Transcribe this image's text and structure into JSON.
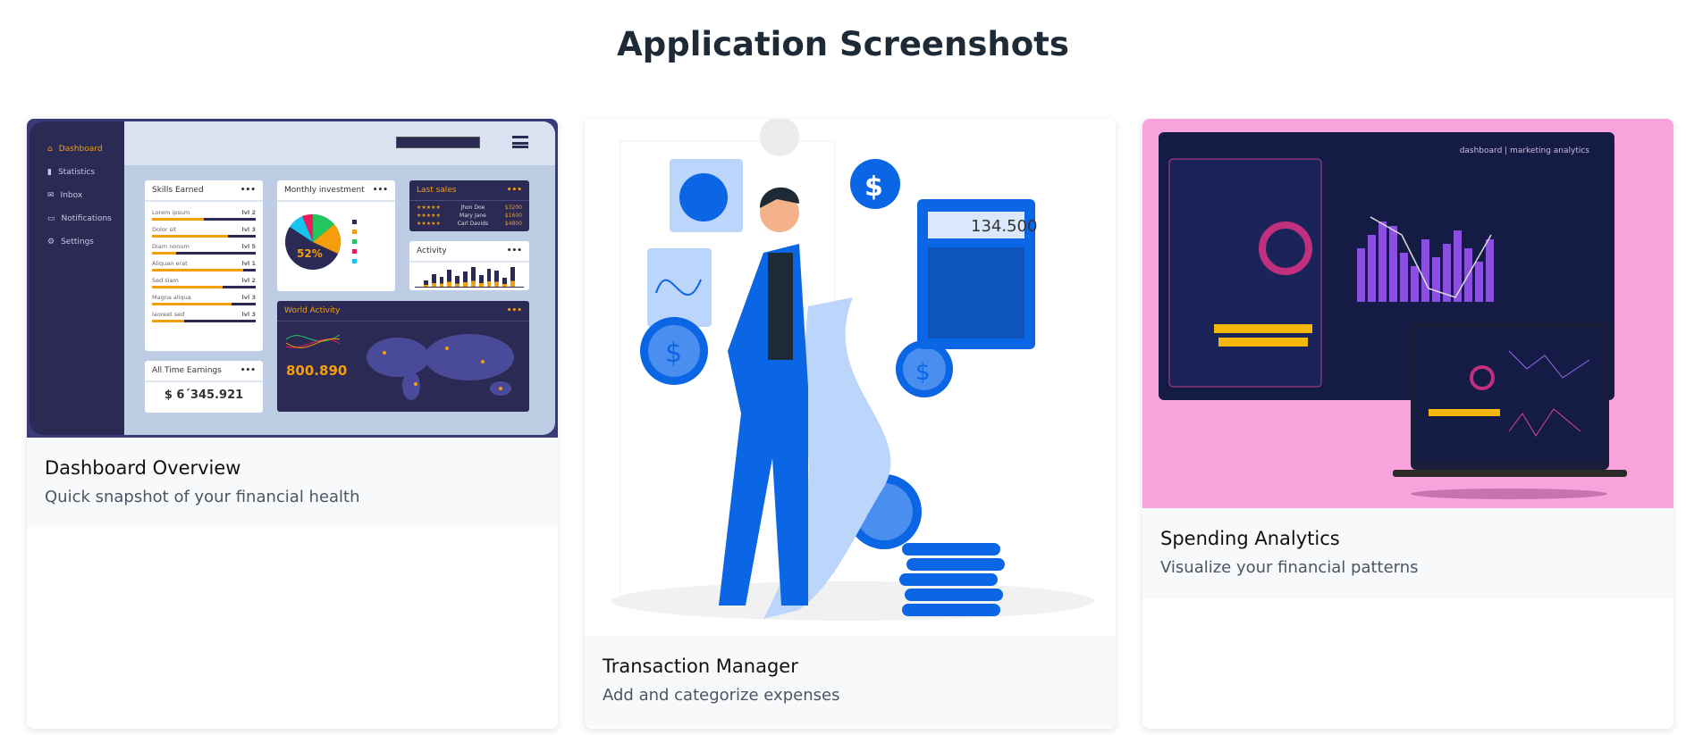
{
  "page": {
    "title": "Application Screenshots"
  },
  "cards": [
    {
      "title": "Dashboard Overview",
      "subtitle": "Quick snapshot of your financial health",
      "mock": {
        "nav": [
          "Dashboard",
          "Statistics",
          "Inbox",
          "Notifications",
          "Settings"
        ],
        "skills": {
          "title": "Skills Earned",
          "rows": [
            {
              "label": "Lorem ipsum",
              "level": "lvl 2",
              "fill": 0.5
            },
            {
              "label": "Dolor sit",
              "level": "lvl 3",
              "fill": 0.73
            },
            {
              "label": "Diam nonum",
              "level": "lvl 5",
              "fill": 0.23
            },
            {
              "label": "Aliquan erat",
              "level": "lvl 1",
              "fill": 0.88
            },
            {
              "label": "Sed siam",
              "level": "lvl 2",
              "fill": 0.68
            },
            {
              "label": "Magna aliqua",
              "level": "lvl 3",
              "fill": 0.77
            },
            {
              "label": "laoreet sed",
              "level": "lvl 3",
              "fill": 0.31
            }
          ]
        },
        "earnings": {
          "title": "All Time Earnings",
          "value": "$ 6´345.921"
        },
        "investment": {
          "title": "Monthly investment",
          "percent": "52%"
        },
        "sales": {
          "title": "Last sales",
          "rows": [
            {
              "name": "Jhon Doe",
              "amount": "$3200"
            },
            {
              "name": "Mary Jane",
              "amount": "$1600"
            },
            {
              "name": "Carl Davids",
              "amount": "$4800"
            }
          ]
        },
        "activity": {
          "title": "Activity",
          "bars": [
            0.3,
            0.6,
            0.45,
            0.8,
            0.5,
            0.7,
            0.9,
            0.55,
            0.85,
            0.75,
            0.4,
            0.9
          ]
        },
        "world": {
          "title": "World Activity",
          "value": "800.890"
        }
      }
    },
    {
      "title": "Transaction Manager",
      "subtitle": "Add and categorize expenses",
      "mock": {
        "calculator": "134.500"
      }
    },
    {
      "title": "Spending Analytics",
      "subtitle": "Visualize your financial patterns",
      "mock": {
        "header": "dashboard | marketing analytics"
      }
    }
  ],
  "colors": {
    "accent": "#f59e0b",
    "navy": "#2b2a55",
    "blue": "#0a66e4",
    "pink": "#f9a3dc"
  }
}
